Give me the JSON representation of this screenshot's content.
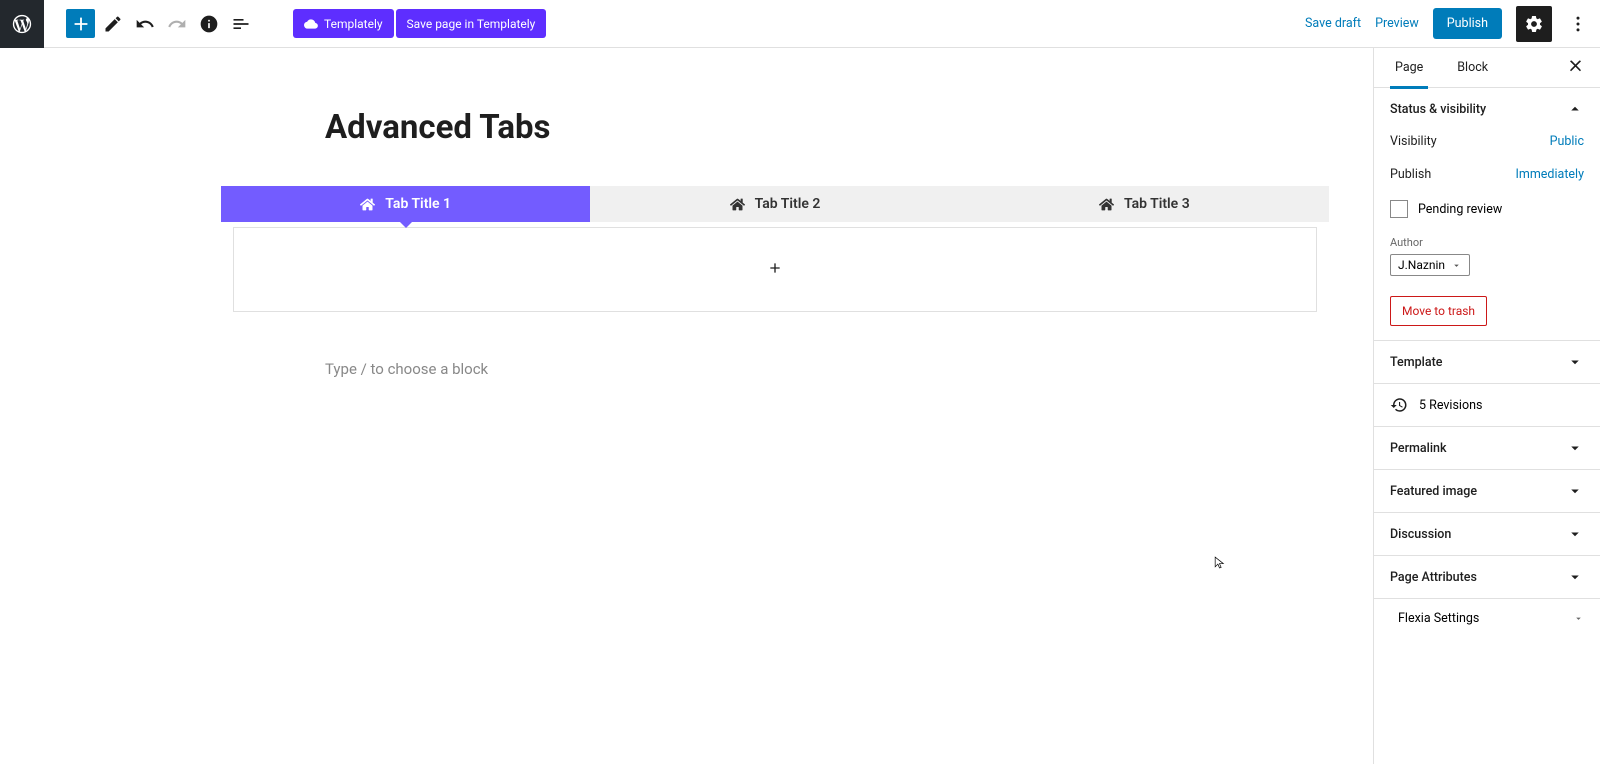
{
  "toolbar": {
    "templately_label": "Templately",
    "save_templately_label": "Save page in Templately",
    "save_draft_label": "Save draft",
    "preview_label": "Preview",
    "publish_label": "Publish"
  },
  "page": {
    "title": "Advanced Tabs",
    "block_prompt": "Type / to choose a block",
    "tabs": [
      {
        "label": "Tab Title 1"
      },
      {
        "label": "Tab Title 2"
      },
      {
        "label": "Tab Title 3"
      }
    ]
  },
  "sidebar": {
    "tabs": {
      "page": "Page",
      "block": "Block"
    },
    "status": {
      "header": "Status & visibility",
      "visibility_label": "Visibility",
      "visibility_value": "Public",
      "publish_label": "Publish",
      "publish_value": "Immediately",
      "pending_label": "Pending review",
      "author_label": "Author",
      "author_value": "J.Naznin",
      "trash_label": "Move to trash"
    },
    "template": "Template",
    "revisions": "5 Revisions",
    "permalink": "Permalink",
    "featured_image": "Featured image",
    "discussion": "Discussion",
    "page_attributes": "Page Attributes",
    "flexia": "Flexia Settings"
  }
}
